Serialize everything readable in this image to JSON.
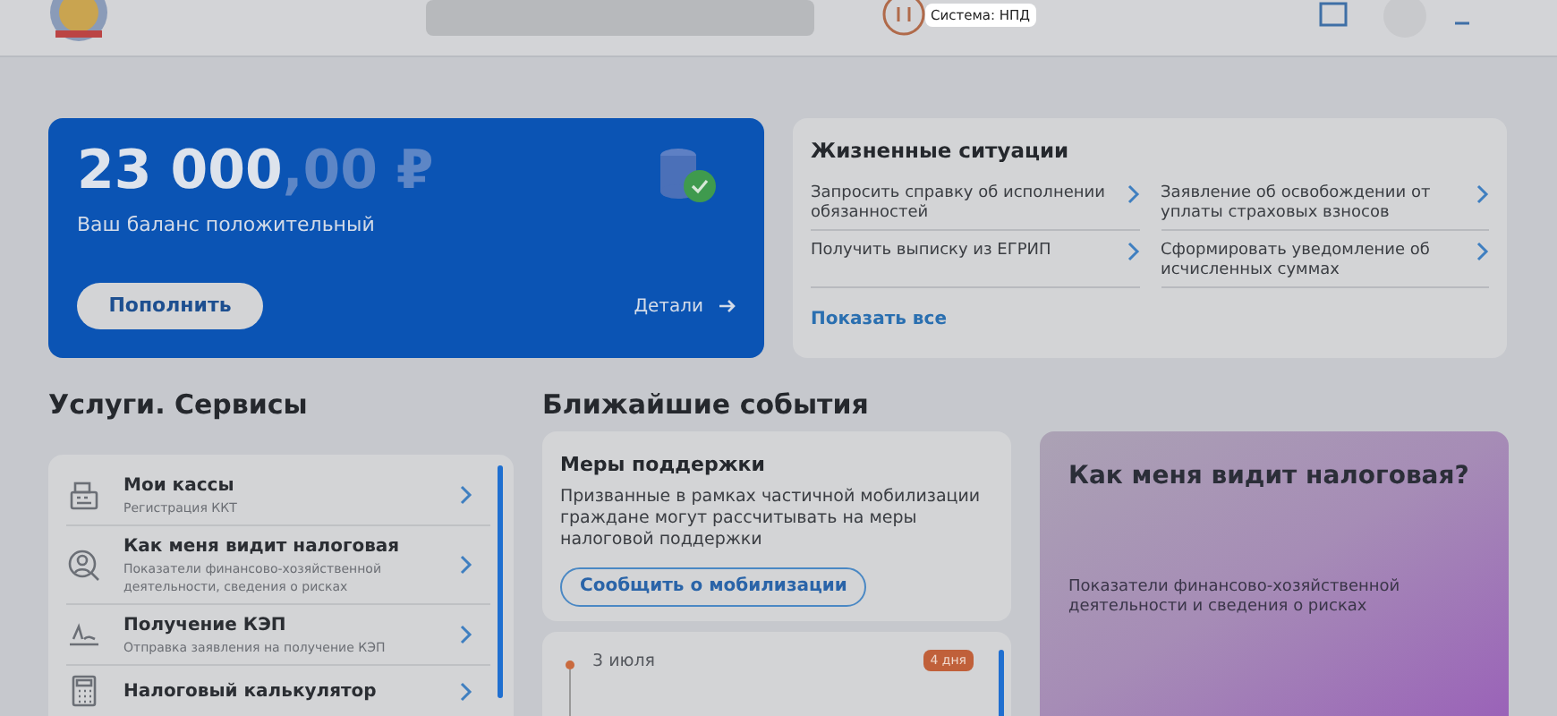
{
  "header": {
    "tooltip": "Система: НПД"
  },
  "balance": {
    "integer": "23 000",
    "fraction": ",00 ₽",
    "caption": "Ваш баланс положительный",
    "button": "Пополнить",
    "details": "Детали"
  },
  "life_situations": {
    "title": "Жизненные ситуации",
    "items": [
      {
        "label": "Запросить справку об исполнении обязанностей"
      },
      {
        "label": "Заявление об освобождении от уплаты страховых взносов"
      },
      {
        "label": "Получить выписку из ЕГРИП"
      },
      {
        "label": "Сформировать уведомление об исчисленных суммах"
      }
    ],
    "show_all": "Показать все"
  },
  "services": {
    "title": "Услуги. Сервисы",
    "items": [
      {
        "kind": "register",
        "title": "Мои кассы",
        "subtitle": "Регистрация ККТ"
      },
      {
        "kind": "profile",
        "title": "Как меня видит налоговая",
        "subtitle": "Показатели финансово-хозяйственной деятельности, сведения о рисках"
      },
      {
        "kind": "signature",
        "title": "Получение КЭП",
        "subtitle": "Отправка заявления на получение КЭП"
      },
      {
        "kind": "calculator",
        "title": "Налоговый калькулятор"
      }
    ]
  },
  "events": {
    "title": "Ближайшие события",
    "support": {
      "title": "Меры поддержки",
      "text": "Призванные в рамках частичной мобилизации граждане могут рассчитывать на меры налоговой поддержки",
      "button": "Сообщить о мобилизации"
    },
    "upcoming": [
      {
        "date": "3 июля",
        "badge": "4 дня"
      }
    ]
  },
  "promo": {
    "title": "Как меня видит налоговая?",
    "text": "Показатели финансово-хозяйственной деятельности и сведения о рисках"
  }
}
